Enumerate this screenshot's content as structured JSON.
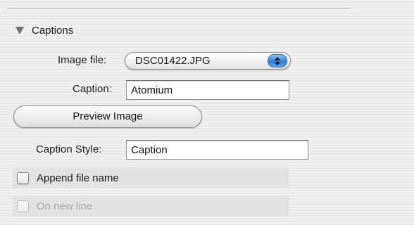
{
  "section": {
    "title": "Captions",
    "expanded_icon": "disclosure-triangle-down"
  },
  "image_file": {
    "label": "Image file:",
    "selected": "DSC01422.JPG",
    "arrows_icon": "popup-up-down-arrows"
  },
  "caption": {
    "label": "Caption:",
    "value": "Atomium"
  },
  "preview_button": {
    "label": "Preview Image"
  },
  "caption_style": {
    "label": "Caption Style:",
    "value": "Caption"
  },
  "append_file_name": {
    "label": "Append file name",
    "checked": false
  },
  "on_new_line": {
    "label": "On new line",
    "checked": false,
    "enabled": false
  },
  "colors": {
    "popup_arrow_accent": "#2f7fd9",
    "disabled_text": "#a9a9a9"
  }
}
